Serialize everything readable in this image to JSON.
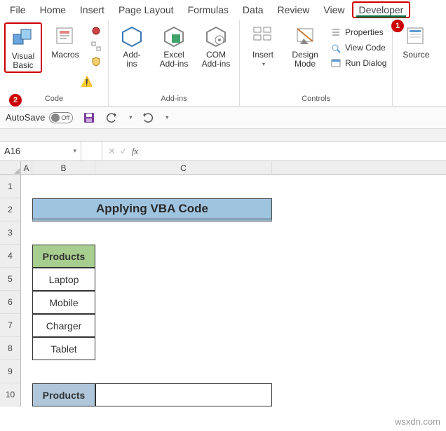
{
  "tabs": {
    "file": "File",
    "home": "Home",
    "insert": "Insert",
    "pagelayout": "Page Layout",
    "formulas": "Formulas",
    "data": "Data",
    "review": "Review",
    "view": "View",
    "developer": "Developer"
  },
  "callouts": {
    "one": "1",
    "two": "2"
  },
  "ribbon": {
    "code": {
      "visual_basic": "Visual\nBasic",
      "macros": "Macros",
      "label": "Code"
    },
    "addins": {
      "addins": "Add-\nins",
      "excel_addins": "Excel\nAdd-ins",
      "com_addins": "COM\nAdd-ins",
      "label": "Add-ins"
    },
    "controls": {
      "insert": "Insert",
      "design_mode": "Design\nMode",
      "properties": "Properties",
      "view_code": "View Code",
      "run_dialog": "Run Dialog",
      "label": "Controls"
    },
    "xml": {
      "source": "Source"
    }
  },
  "qat": {
    "autosave": "AutoSave",
    "off": "Off"
  },
  "namebox": "A16",
  "sheet": {
    "columns": [
      "A",
      "B",
      "C"
    ],
    "rows": [
      "1",
      "2",
      "3",
      "4",
      "5",
      "6",
      "7",
      "8",
      "9",
      "10"
    ],
    "title": "Applying VBA Code",
    "products_header": "Products",
    "products": [
      "Laptop",
      "Mobile",
      "Charger",
      "Tablet"
    ],
    "products_header2": "Products"
  },
  "watermark": "wsxdn.com"
}
